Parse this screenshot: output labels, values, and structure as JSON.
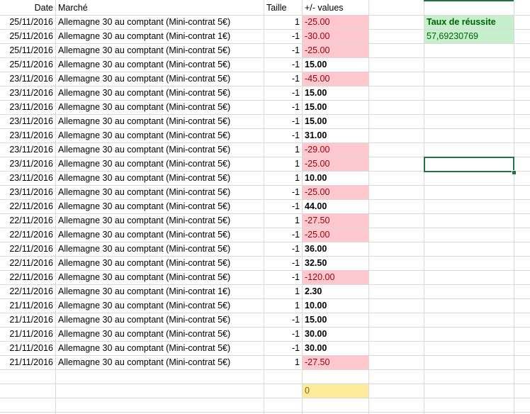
{
  "headers": {
    "date": "Date",
    "market": "Marché",
    "size": "Taille",
    "values": "+/- values"
  },
  "rows": [
    {
      "date": "25/11/2016",
      "market": "Allemagne 30 au comptant (Mini-contrat 5€)",
      "size": "1",
      "value": "-25.00",
      "neg": true
    },
    {
      "date": "25/11/2016",
      "market": "Allemagne 30 au comptant (Mini-contrat 1€)",
      "size": "-1",
      "value": "-30.00",
      "neg": true
    },
    {
      "date": "25/11/2016",
      "market": "Allemagne 30 au comptant (Mini-contrat 5€)",
      "size": "-1",
      "value": "-25.00",
      "neg": true
    },
    {
      "date": "25/11/2016",
      "market": "Allemagne 30 au comptant (Mini-contrat 5€)",
      "size": "-1",
      "value": "15.00",
      "neg": false
    },
    {
      "date": "23/11/2016",
      "market": "Allemagne 30 au comptant (Mini-contrat 5€)",
      "size": "-1",
      "value": "-45.00",
      "neg": true
    },
    {
      "date": "23/11/2016",
      "market": "Allemagne 30 au comptant (Mini-contrat 5€)",
      "size": "-1",
      "value": "15.00",
      "neg": false
    },
    {
      "date": "23/11/2016",
      "market": "Allemagne 30 au comptant (Mini-contrat 5€)",
      "size": "-1",
      "value": "15.00",
      "neg": false
    },
    {
      "date": "23/11/2016",
      "market": "Allemagne 30 au comptant (Mini-contrat 5€)",
      "size": "-1",
      "value": "15.00",
      "neg": false
    },
    {
      "date": "23/11/2016",
      "market": "Allemagne 30 au comptant (Mini-contrat 5€)",
      "size": "-1",
      "value": "31.00",
      "neg": false
    },
    {
      "date": "23/11/2016",
      "market": "Allemagne 30 au comptant (Mini-contrat 5€)",
      "size": "1",
      "value": "-29.00",
      "neg": true
    },
    {
      "date": "23/11/2016",
      "market": "Allemagne 30 au comptant (Mini-contrat 5€)",
      "size": "1",
      "value": "-25.00",
      "neg": true
    },
    {
      "date": "23/11/2016",
      "market": "Allemagne 30 au comptant (Mini-contrat 5€)",
      "size": "1",
      "value": "10.00",
      "neg": false
    },
    {
      "date": "23/11/2016",
      "market": "Allemagne 30 au comptant (Mini-contrat 5€)",
      "size": "-1",
      "value": "-25.00",
      "neg": true
    },
    {
      "date": "22/11/2016",
      "market": "Allemagne 30 au comptant (Mini-contrat 5€)",
      "size": "-1",
      "value": "44.00",
      "neg": false
    },
    {
      "date": "22/11/2016",
      "market": "Allemagne 30 au comptant (Mini-contrat 5€)",
      "size": "1",
      "value": "-27.50",
      "neg": true
    },
    {
      "date": "22/11/2016",
      "market": "Allemagne 30 au comptant (Mini-contrat 5€)",
      "size": "-1",
      "value": "-25.00",
      "neg": true
    },
    {
      "date": "22/11/2016",
      "market": "Allemagne 30 au comptant (Mini-contrat 5€)",
      "size": "-1",
      "value": "36.00",
      "neg": false
    },
    {
      "date": "22/11/2016",
      "market": "Allemagne 30 au comptant (Mini-contrat 5€)",
      "size": "-1",
      "value": "32.50",
      "neg": false
    },
    {
      "date": "22/11/2016",
      "market": "Allemagne 30 au comptant (Mini-contrat 5€)",
      "size": "-1",
      "value": "-120.00",
      "neg": true
    },
    {
      "date": "22/11/2016",
      "market": "Allemagne 30 au comptant (Mini-contrat 1€)",
      "size": "1",
      "value": "2.30",
      "neg": false
    },
    {
      "date": "21/11/2016",
      "market": "Allemagne 30 au comptant (Mini-contrat 5€)",
      "size": "1",
      "value": "10.00",
      "neg": false
    },
    {
      "date": "21/11/2016",
      "market": "Allemagne 30 au comptant (Mini-contrat 5€)",
      "size": "-1",
      "value": "15.00",
      "neg": false
    },
    {
      "date": "21/11/2016",
      "market": "Allemagne 30 au comptant (Mini-contrat 5€)",
      "size": "-1",
      "value": "30.00",
      "neg": false
    },
    {
      "date": "21/11/2016",
      "market": "Allemagne 30 au comptant (Mini-contrat 5€)",
      "size": "-1",
      "value": "30.00",
      "neg": false
    },
    {
      "date": "21/11/2016",
      "market": "Allemagne 30 au comptant (Mini-contrat 5€)",
      "size": "1",
      "value": "-27.50",
      "neg": true
    }
  ],
  "total": "0",
  "success": {
    "label": "Taux de réussite",
    "value": "57,69230769"
  },
  "colors": {
    "neg_fill": "#ffc7ce",
    "neg_text": "#9c0006",
    "good_fill": "#c6efce",
    "good_text": "#006100",
    "neutral_fill": "#ffeb9c",
    "neutral_text": "#9c5700",
    "selection": "#217346"
  }
}
